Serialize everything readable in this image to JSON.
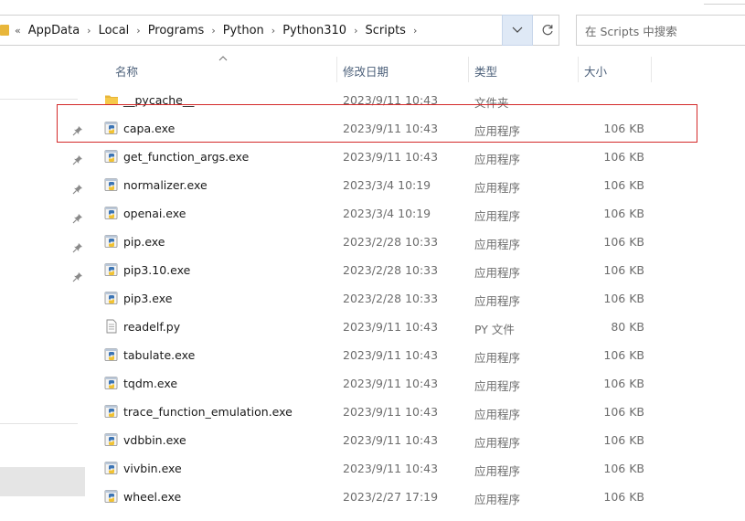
{
  "address_bar": {
    "overflow_glyph": "«",
    "crumbs": [
      "AppData",
      "Local",
      "Programs",
      "Python",
      "Python310",
      "Scripts"
    ],
    "separator": "›"
  },
  "search": {
    "placeholder": "在 Scripts 中搜索"
  },
  "columns": {
    "name": "名称",
    "modified": "修改日期",
    "type": "类型",
    "size": "大小"
  },
  "files": [
    {
      "name": "__pycache__",
      "modified": "2023/9/11 10:43",
      "type": "文件夹",
      "size": "",
      "icon": "folder-icon"
    },
    {
      "name": "capa.exe",
      "modified": "2023/9/11 10:43",
      "type": "应用程序",
      "size": "106 KB",
      "icon": "python-exe-icon"
    },
    {
      "name": "get_function_args.exe",
      "modified": "2023/9/11 10:43",
      "type": "应用程序",
      "size": "106 KB",
      "icon": "python-exe-icon"
    },
    {
      "name": "normalizer.exe",
      "modified": "2023/3/4 10:19",
      "type": "应用程序",
      "size": "106 KB",
      "icon": "python-exe-icon"
    },
    {
      "name": "openai.exe",
      "modified": "2023/3/4 10:19",
      "type": "应用程序",
      "size": "106 KB",
      "icon": "python-exe-icon"
    },
    {
      "name": "pip.exe",
      "modified": "2023/2/28 10:33",
      "type": "应用程序",
      "size": "106 KB",
      "icon": "python-exe-icon"
    },
    {
      "name": "pip3.10.exe",
      "modified": "2023/2/28 10:33",
      "type": "应用程序",
      "size": "106 KB",
      "icon": "python-exe-icon"
    },
    {
      "name": "pip3.exe",
      "modified": "2023/2/28 10:33",
      "type": "应用程序",
      "size": "106 KB",
      "icon": "python-exe-icon"
    },
    {
      "name": "readelf.py",
      "modified": "2023/9/11 10:43",
      "type": "PY 文件",
      "size": "80 KB",
      "icon": "text-file-icon"
    },
    {
      "name": "tabulate.exe",
      "modified": "2023/9/11 10:43",
      "type": "应用程序",
      "size": "106 KB",
      "icon": "python-exe-icon"
    },
    {
      "name": "tqdm.exe",
      "modified": "2023/9/11 10:43",
      "type": "应用程序",
      "size": "106 KB",
      "icon": "python-exe-icon"
    },
    {
      "name": "trace_function_emulation.exe",
      "modified": "2023/9/11 10:43",
      "type": "应用程序",
      "size": "106 KB",
      "icon": "python-exe-icon"
    },
    {
      "name": "vdbbin.exe",
      "modified": "2023/9/11 10:43",
      "type": "应用程序",
      "size": "106 KB",
      "icon": "python-exe-icon"
    },
    {
      "name": "vivbin.exe",
      "modified": "2023/9/11 10:43",
      "type": "应用程序",
      "size": "106 KB",
      "icon": "python-exe-icon"
    },
    {
      "name": "wheel.exe",
      "modified": "2023/2/27 17:19",
      "type": "应用程序",
      "size": "106 KB",
      "icon": "python-exe-icon"
    }
  ],
  "highlighted_file": "capa.exe",
  "colors": {
    "highlight": "#d42a2a",
    "header_text": "#4c607a",
    "folder": "#e8b63a"
  }
}
